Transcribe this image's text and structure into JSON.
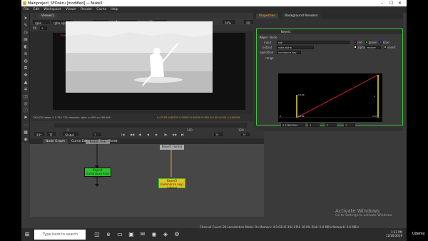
{
  "window": {
    "title": "Mainproject_SFDokru [modified] — NukeX",
    "minimize": "–",
    "maximize": "☐",
    "close": "✕"
  },
  "menu": [
    "File",
    "Edit",
    "Workspace",
    "Viewer",
    "Render",
    "Cache",
    "Help"
  ],
  "toolbar_icons": [
    "pointer-icon",
    "draw-icon",
    "time-icon",
    "channel-icon",
    "color-icon",
    "filter-icon",
    "keyer-icon",
    "merge-icon",
    "transform-icon",
    "3d-icon",
    "particles-icon",
    "deep-icon",
    "views-icon",
    "metadata-icon",
    "toolsets-icon",
    "other-icon",
    "furnace-icon",
    "ocula-icon"
  ],
  "viewer": {
    "tab": "Viewer1",
    "channels": "rgba",
    "alpha": "rgba.alpha",
    "colorspace": "sRGB",
    "input_a": "A",
    "node_a": "Keyer1",
    "input_b": "B",
    "node_b": "-",
    "zoom": "50%",
    "view": "2D",
    "overlay_label": "720x720 bbox",
    "gain_label": "f/8",
    "gain": "1",
    "gamma_label": "Y",
    "gamma": "1",
    "status": "750x720  bbox: 0 0 750 720 channels: rgba  x=400 y=450 Ko8",
    "status_values": "0.07183  0.80255  0.00000  0.50000   H:360 S:0.00 V:0.00 L:0.00000"
  },
  "timeline": {
    "frame_labels": [
      "1",
      "100",
      "120"
    ],
    "fps": "24*",
    "mode": "TF",
    "global": "Global",
    "frame": "1",
    "step": "10",
    "counter": "10",
    "transport": [
      "|◀",
      "◀◀",
      "◀|",
      "◀",
      "▶",
      "|▶",
      "▶▶",
      "▶|"
    ]
  },
  "node_graph": {
    "tabs": [
      "Node Graph",
      "Curve Editor",
      "Dope Sheet"
    ],
    "nodes": [
      {
        "label": "Read2 / Ink"
      },
      {
        "label": "Keyer1 (luminance key)\n(alpha)"
      },
      {
        "label": "Keyer1 (luma)"
      },
      {
        "label": "Keyer3 (luminance key)\n(alpha)"
      }
    ]
  },
  "properties": {
    "tabs": [
      "Properties",
      "Background Renders"
    ],
    "node_name": "Keyer1",
    "subtabs": [
      "Keyer",
      "Node"
    ],
    "input_label": "input",
    "input_value": "rgb",
    "output_label": "output",
    "output_value": "rgba.alpha",
    "operation_label": "operation",
    "operation_value": "luminance key",
    "range_label": "range",
    "channels": [
      {
        "name": "red",
        "color": "#d02020"
      },
      {
        "name": "green",
        "color": "#20c020"
      },
      {
        "name": "blue",
        "color": "#2050e0"
      },
      {
        "name": "alpha",
        "color": "#ffffff"
      }
    ],
    "combine_value": "replace",
    "invert_label": "invert",
    "curve_values": [
      "0.129",
      "1",
      "0",
      "0.129",
      "1.07"
    ],
    "range_field": "0.12809994",
    "range_a": "1",
    "range_b": "1",
    "range_c": "1"
  },
  "status_bar": "Channel Count: 26  Localization Mode: On  Memory: 4.0 GB (6.3%)  CPU: 16.0%  Disk: 0.0 MB/s  Network: 0.0 MB/s",
  "watermark": {
    "line1": "Activate Windows",
    "line2": "Go to Settings to activate Windows."
  },
  "taskbar": {
    "search_placeholder": "Type here to search",
    "time": "1:31 PM",
    "date": "12/20/2019",
    "brand": "Udemy"
  }
}
